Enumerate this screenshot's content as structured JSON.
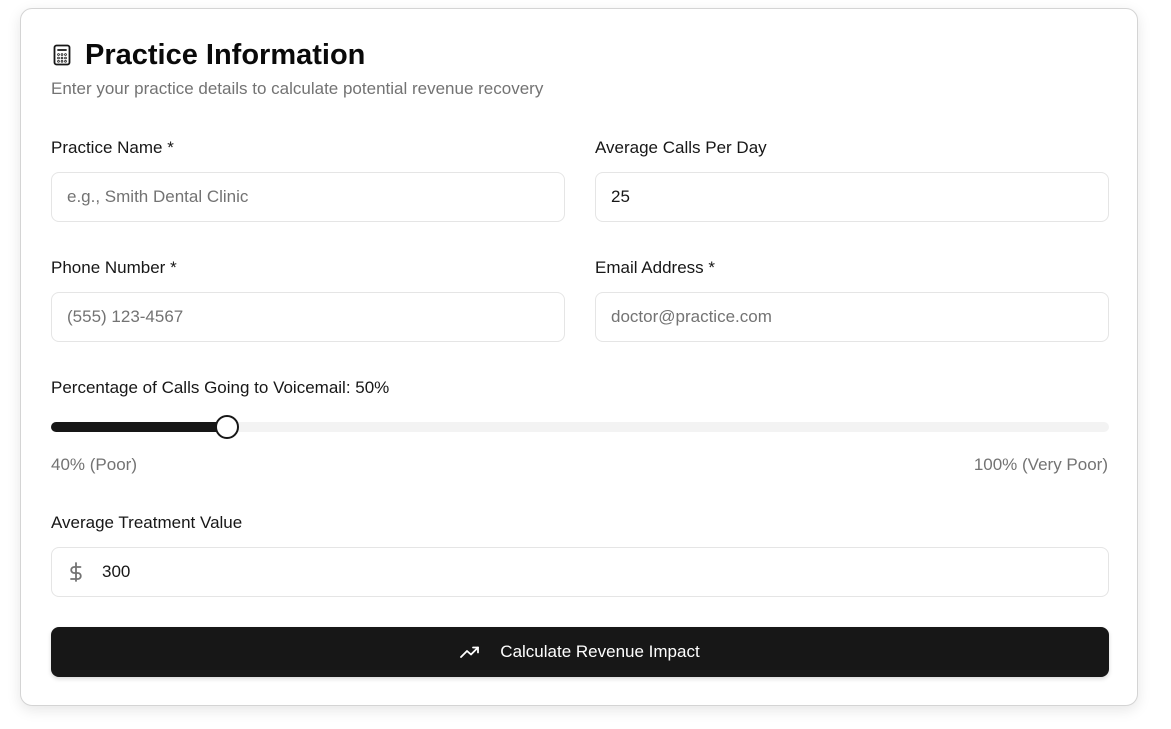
{
  "header": {
    "title": "Practice Information",
    "subtitle": "Enter your practice details to calculate potential revenue recovery",
    "icon": "calculator-icon"
  },
  "fields": {
    "practice_name": {
      "label": "Practice Name *",
      "value": "",
      "placeholder": "e.g., Smith Dental Clinic"
    },
    "calls_per_day": {
      "label": "Average Calls Per Day",
      "value": "25",
      "placeholder": ""
    },
    "phone": {
      "label": "Phone Number *",
      "value": "",
      "placeholder": "(555) 123-4567"
    },
    "email": {
      "label": "Email Address *",
      "value": "",
      "placeholder": "doctor@practice.com"
    },
    "treatment_value": {
      "label": "Average Treatment Value",
      "value": "300",
      "placeholder": "",
      "icon": "dollar-icon"
    }
  },
  "voicemail_slider": {
    "label": "Percentage of Calls Going to Voicemail: 50%",
    "value_percent": 50,
    "min_percent": 40,
    "max_percent": 100,
    "min_label": "40% (Poor)",
    "max_label": "100% (Very Poor)"
  },
  "submit_button": {
    "label": "Calculate Revenue Impact",
    "icon": "trending-up-icon"
  },
  "colors": {
    "primary": "#171717",
    "muted_text": "#737373",
    "border": "#e5e5e5",
    "track": "#f3f3f3"
  }
}
